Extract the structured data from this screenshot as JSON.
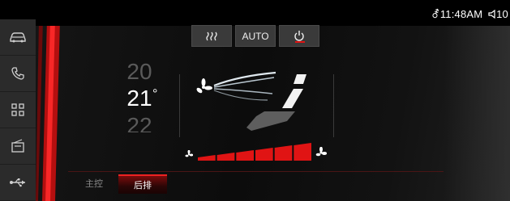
{
  "status_bar": {
    "time": "11:48AM",
    "volume": "10"
  },
  "sidebar": {
    "items": [
      {
        "id": "car",
        "icon": "car-icon"
      },
      {
        "id": "phone",
        "icon": "phone-icon"
      },
      {
        "id": "apps",
        "icon": "apps-grid-icon"
      },
      {
        "id": "media",
        "icon": "radio-icon"
      },
      {
        "id": "usb",
        "icon": "usb-icon"
      }
    ]
  },
  "climate": {
    "modes": [
      {
        "id": "rear_defrost",
        "icon": "rear-defrost-icon"
      },
      {
        "id": "auto",
        "label": "AUTO"
      },
      {
        "id": "power",
        "icon": "power-icon",
        "active": true
      }
    ],
    "temperature": {
      "above": "20",
      "current": "21",
      "below": "22",
      "unit": "°"
    },
    "fan_speed": {
      "level": 6,
      "max": 6
    }
  },
  "tabs": [
    {
      "label": "主控",
      "active": false
    },
    {
      "label": "后排",
      "active": true
    }
  ],
  "colors": {
    "accent": "#e01414",
    "panel": "#111111",
    "sidebar": "#2b2b2b"
  }
}
